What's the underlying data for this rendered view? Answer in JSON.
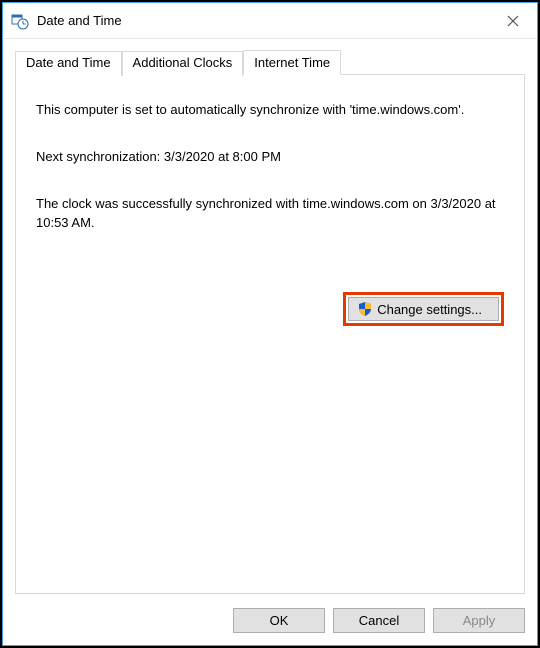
{
  "window": {
    "title": "Date and Time"
  },
  "tabs": [
    {
      "label": "Date and Time"
    },
    {
      "label": "Additional Clocks"
    },
    {
      "label": "Internet Time"
    }
  ],
  "panel": {
    "sync_info": "This computer is set to automatically synchronize with 'time.windows.com'.",
    "next_sync": "Next synchronization: 3/3/2020 at 8:00 PM",
    "last_sync": "The clock was successfully synchronized with time.windows.com on 3/3/2020 at 10:53 AM.",
    "change_settings_label": "Change settings..."
  },
  "buttons": {
    "ok": "OK",
    "cancel": "Cancel",
    "apply": "Apply"
  }
}
